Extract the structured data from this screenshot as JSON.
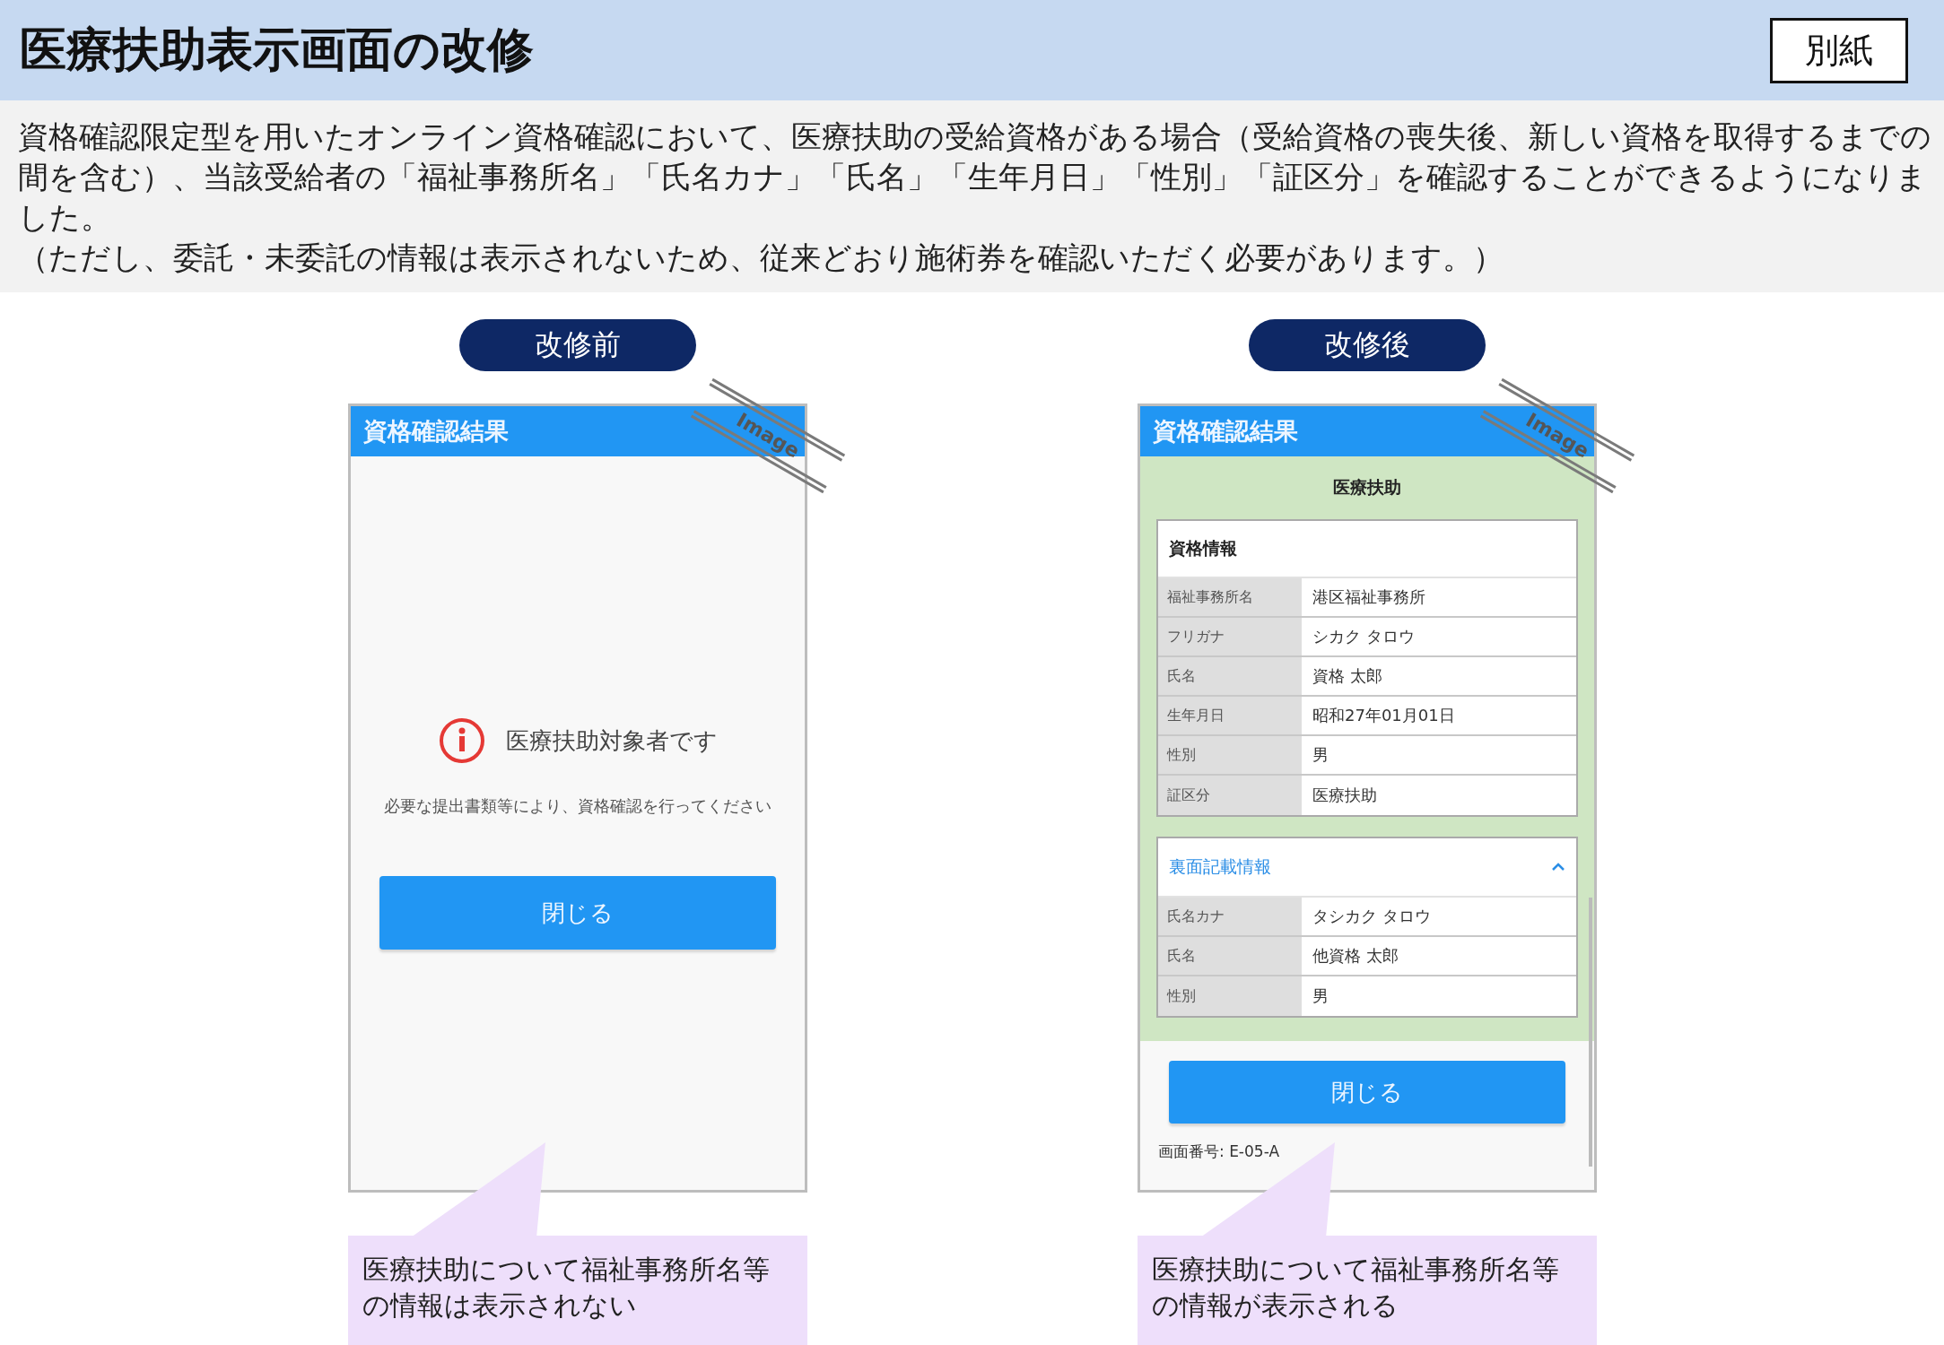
{
  "header": {
    "title": "医療扶助表示画面の改修",
    "badge": "別紙"
  },
  "description": [
    "資格確認限定型を用いたオンライン資格確認において、医療扶助の受給資格がある場合（受給資格の喪失後、新しい資格を取得するまでの間を含む）、当該受給者の「福祉事務所名」「氏名カナ」「氏名」「生年月日」「性別」「証区分」を確認することができるようになりました。",
    "（ただし、委託・未委託の情報は表示されないため、従来どおり施術券を確認いただく必要があります。）"
  ],
  "panels": [
    {
      "label": "改修前",
      "screen": {
        "kind": "message",
        "title": "資格確認結果",
        "stamp": "Image",
        "message": "医療扶助対象者です",
        "note": "必要な提出書類等により、資格確認を行ってください",
        "button": "閉じる"
      },
      "callout": "医療扶助について福祉事務所名等の情報は表示されない"
    },
    {
      "label": "改修後",
      "screen": {
        "kind": "details",
        "title": "資格確認結果",
        "stamp": "Image",
        "section_title": "医療扶助",
        "cards": [
          {
            "kind": "plain",
            "title": "資格情報",
            "rows": [
              {
                "label": "福祉事務所名",
                "value": "港区福祉事務所"
              },
              {
                "label": "フリガナ",
                "value": "シカク タロウ"
              },
              {
                "label": "氏名",
                "value": "資格 太郎"
              },
              {
                "label": "生年月日",
                "value": "昭和27年01月01日"
              },
              {
                "label": "性別",
                "value": "男"
              },
              {
                "label": "証区分",
                "value": "医療扶助"
              }
            ]
          },
          {
            "kind": "collapsible",
            "title": "裏面記載情報",
            "expanded": true,
            "rows": [
              {
                "label": "氏名カナ",
                "value": "タシカク タロウ"
              },
              {
                "label": "氏名",
                "value": "他資格 太郎"
              },
              {
                "label": "性別",
                "value": "男"
              }
            ]
          }
        ],
        "button": "閉じる",
        "screen_number": "画面番号: E-05-A"
      },
      "callout": "医療扶助について福祉事務所名等の情報が表示される"
    }
  ]
}
